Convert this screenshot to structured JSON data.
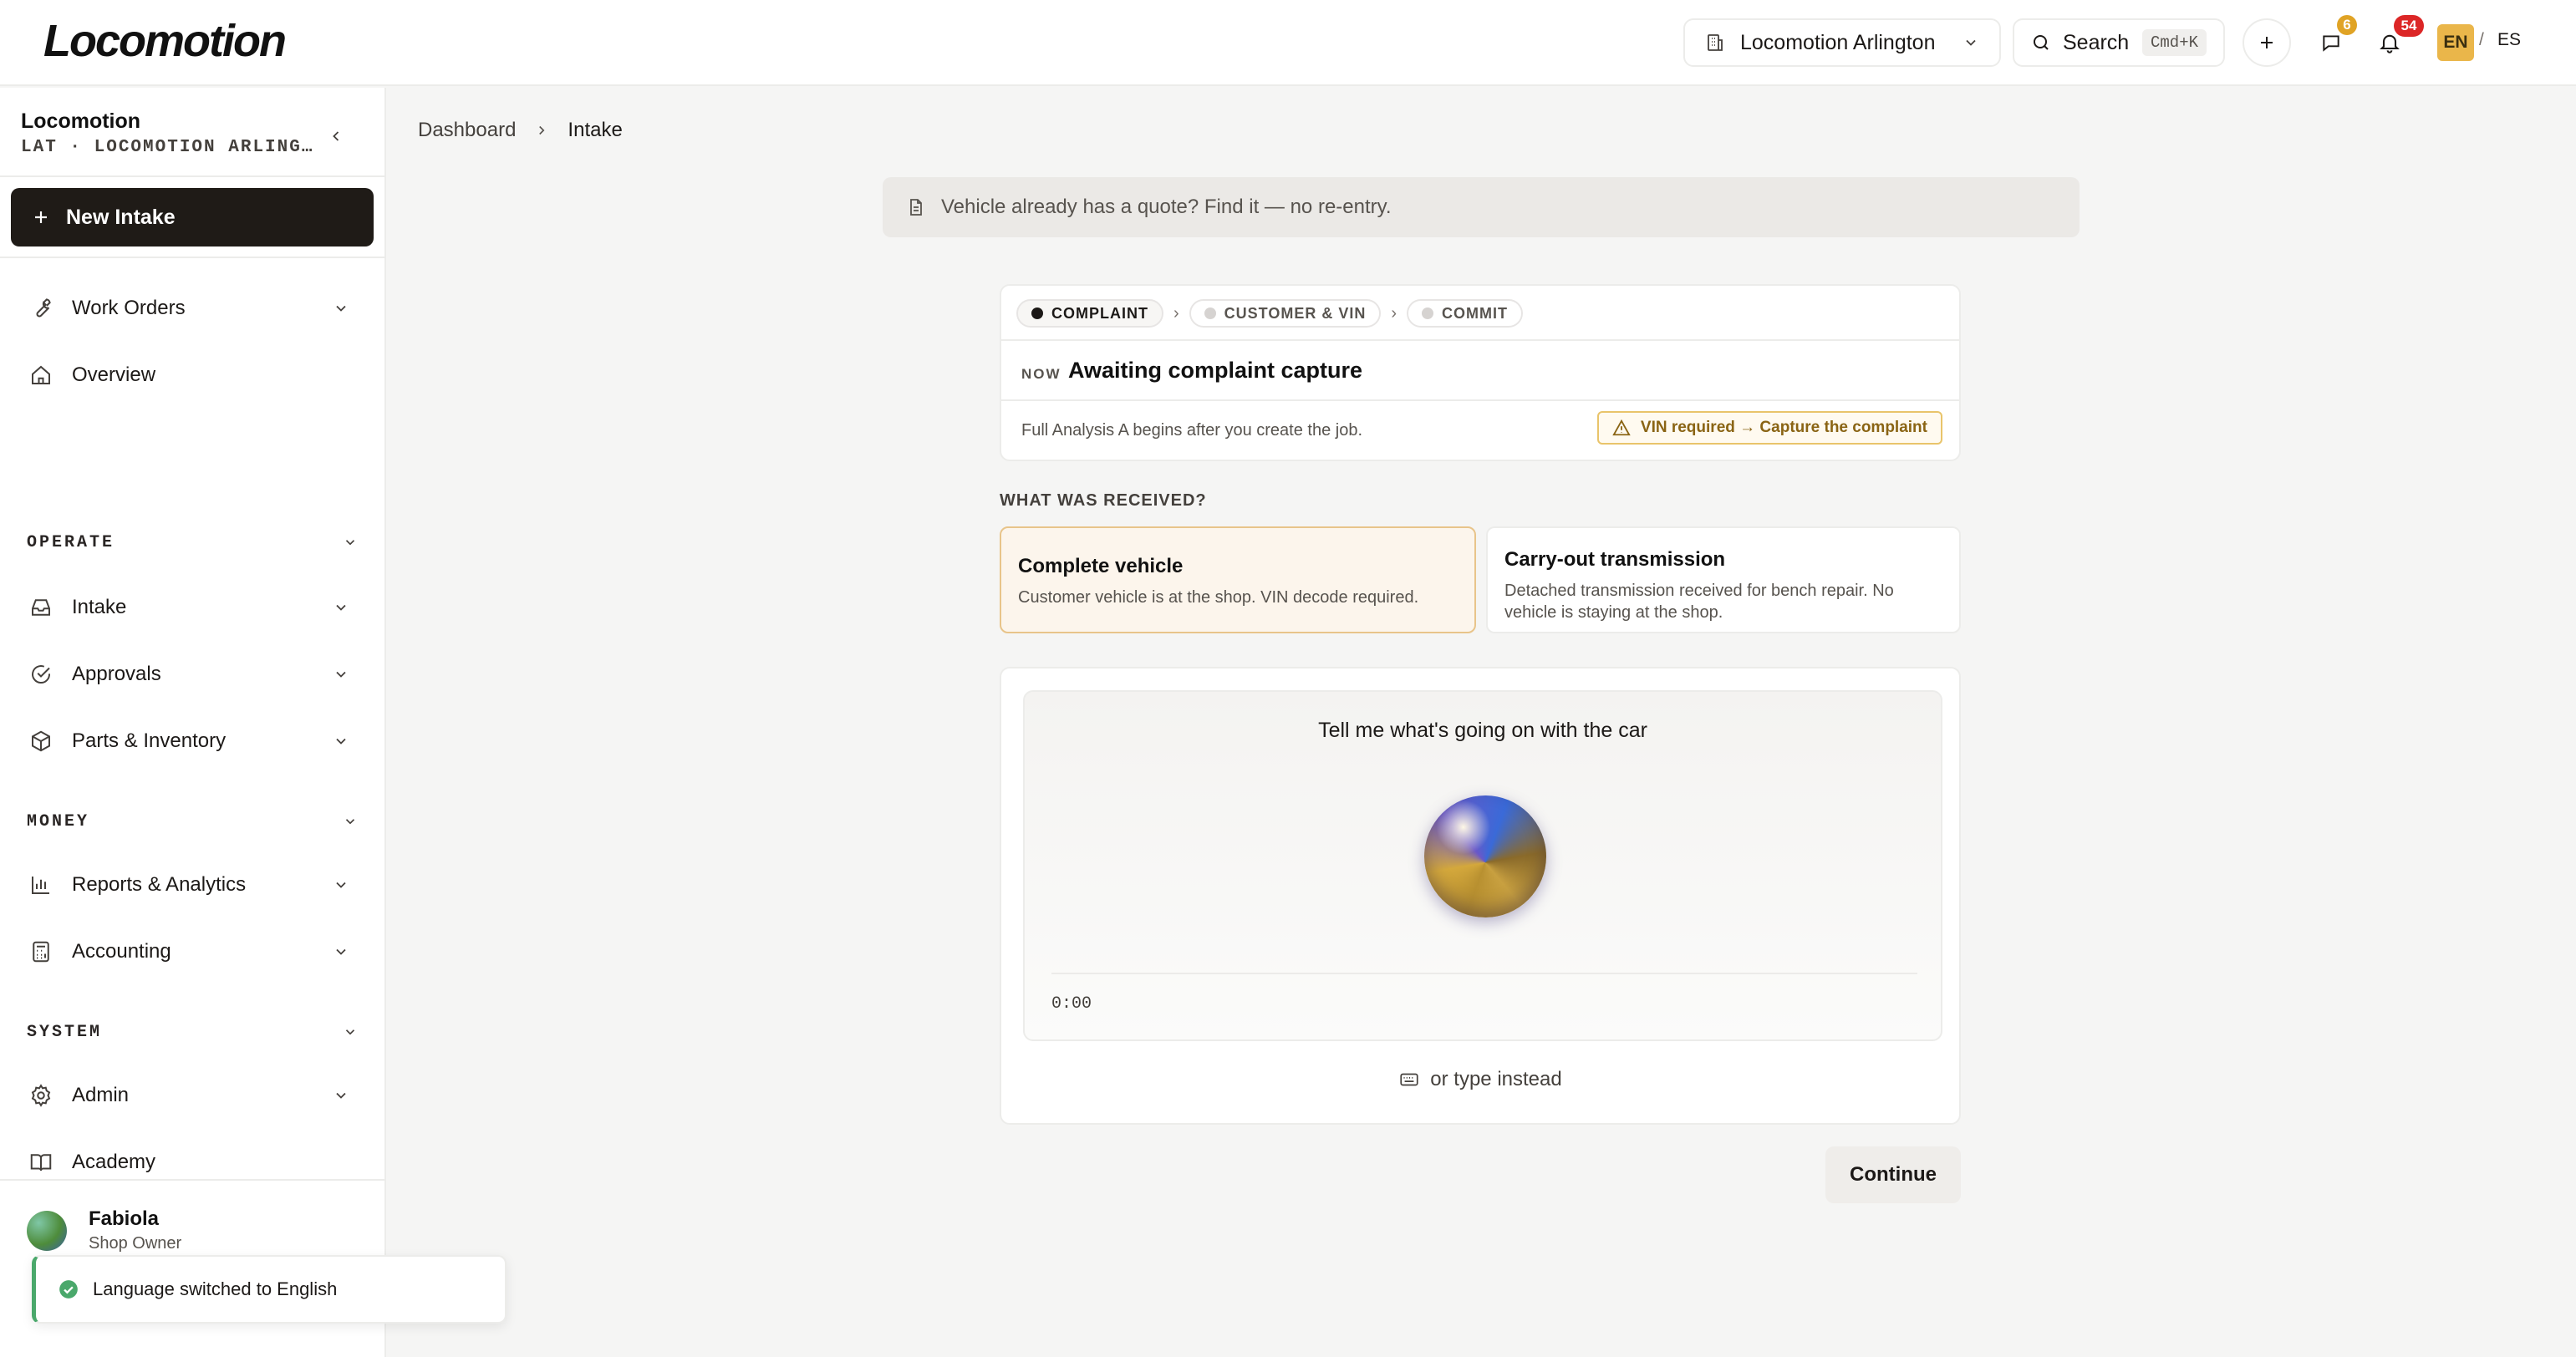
{
  "app": {
    "logo": "Locomotion"
  },
  "header": {
    "location": "Locomotion Arlington",
    "search_label": "Search",
    "search_shortcut": "Cmd+K",
    "messages_count": "6",
    "notifications_count": "54",
    "lang_active": "EN",
    "lang_separator": "/",
    "lang_other": "ES"
  },
  "sidebar": {
    "org_name": "Locomotion",
    "org_sub": "LAT · LOCOMOTION ARLING…",
    "new_intake": "New Intake",
    "items": [
      {
        "label": "Work Orders"
      },
      {
        "label": "Overview"
      },
      {
        "label": "Intake"
      },
      {
        "label": "Approvals"
      },
      {
        "label": "Parts & Inventory"
      },
      {
        "label": "Reports & Analytics"
      },
      {
        "label": "Accounting"
      },
      {
        "label": "Admin"
      },
      {
        "label": "Academy"
      }
    ],
    "sections": {
      "operate": "OPERATE",
      "money": "MONEY",
      "system": "SYSTEM"
    },
    "user": {
      "name": "Fabiola",
      "role": "Shop Owner"
    },
    "toast": "Language switched to English"
  },
  "main": {
    "breadcrumb": [
      "Dashboard",
      "Intake"
    ],
    "notice": "Vehicle already has a quote? Find it — no re-entry.",
    "steps": [
      "COMPLAINT",
      "CUSTOMER & VIN",
      "COMMIT"
    ],
    "now_label": "NOW",
    "now_text": "Awaiting complaint capture",
    "analysis_note": "Full Analysis A begins after you create the job.",
    "warning": "VIN required → Capture the complaint",
    "received_label": "WHAT WAS RECEIVED?",
    "options": [
      {
        "title": "Complete vehicle",
        "desc": "Customer vehicle is at the shop. VIN decode required."
      },
      {
        "title": "Carry-out transmission",
        "desc": "Detached transmission received for bench repair. No vehicle is staying at the shop."
      }
    ],
    "voice_prompt": "Tell me what's going on with the car",
    "timer": "0:00",
    "type_instead": "or type instead",
    "continue": "Continue"
  },
  "colors": {
    "accent": "#eab64a",
    "primary_button": "#1f1b17",
    "badge_red": "#dc2626",
    "badge_amber": "#e0a325",
    "success": "#4aa86b",
    "warning_text": "#8a6414"
  },
  "icons": {
    "location": "building-icon",
    "search": "search-icon",
    "add": "plus-icon",
    "messages": "chat-icon",
    "notifications": "bell-icon",
    "work_orders": "wrench-icon",
    "overview": "home-icon",
    "intake": "inbox-icon",
    "approvals": "check-circle-icon",
    "parts": "box-icon",
    "reports": "bar-chart-icon",
    "accounting": "calculator-icon",
    "admin": "gear-icon",
    "academy": "book-icon"
  }
}
